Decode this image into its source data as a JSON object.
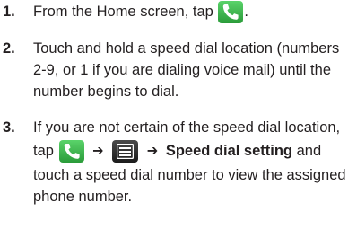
{
  "steps": [
    {
      "number": "1.",
      "text_before": "From the Home screen, tap",
      "icon": "phone-icon",
      "text_after": "."
    },
    {
      "number": "2.",
      "lines": [
        "Touch and hold a speed dial location (numbers",
        "2-9, or 1 if you are dialing voice mail) until the",
        "number begins to dial."
      ]
    },
    {
      "number": "3.",
      "line1": "If you are not certain of the speed dial location,",
      "tap": "tap",
      "icons": [
        "phone-icon",
        "menu-icon"
      ],
      "arrow": "➔",
      "menu_item": "Speed dial setting",
      "after_menu": "and",
      "lines": [
        "touch a speed dial number to view the assigned",
        "phone number."
      ]
    }
  ]
}
